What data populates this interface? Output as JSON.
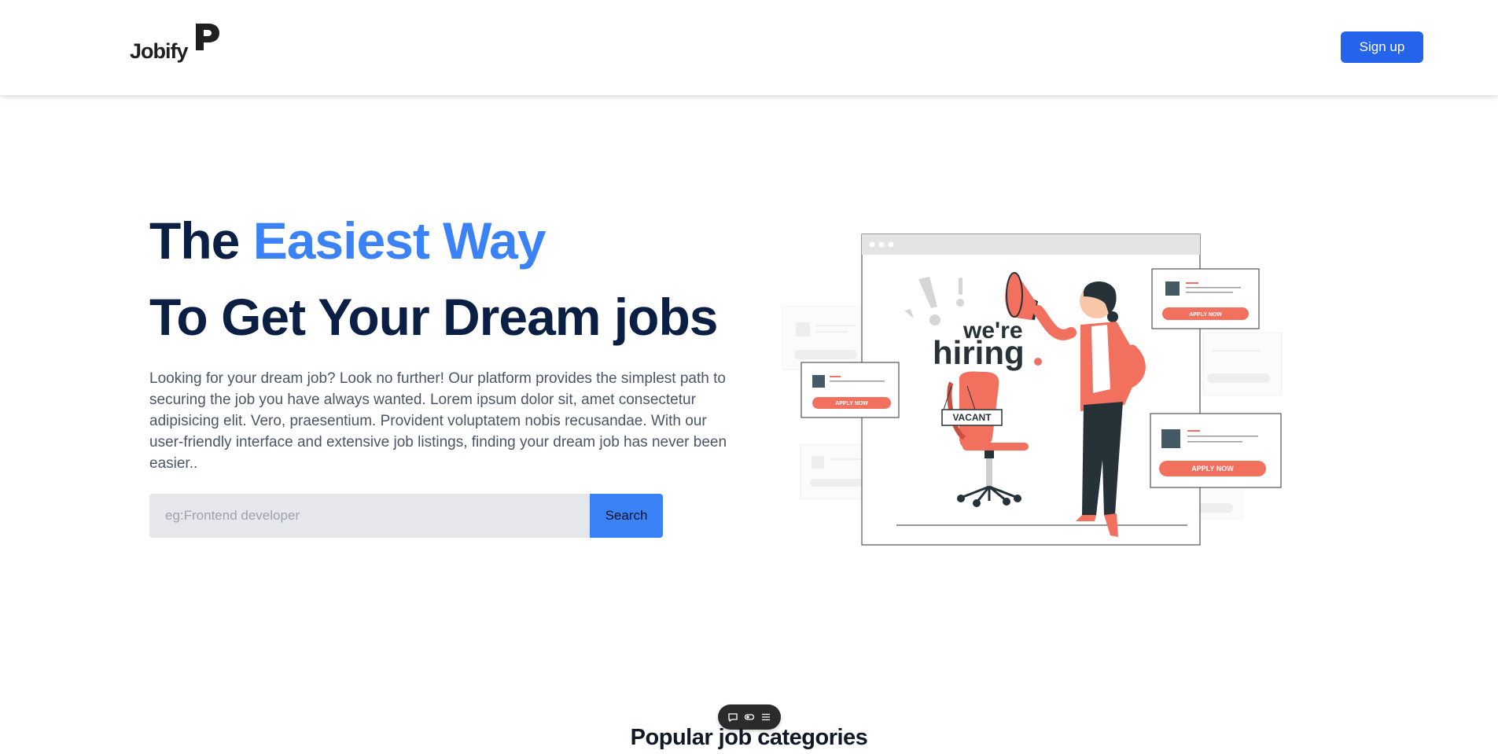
{
  "header": {
    "logo_text": "Jobify",
    "signup_label": "Sign up"
  },
  "hero": {
    "title_prefix": "The ",
    "title_accent": "Easiest Way",
    "title_line2": "To Get Your Dream jobs",
    "description": "Looking for your dream job? Look no further! Our platform provides the simplest path to securing the job you have always wanted. Lorem ipsum dolor sit, amet consectetur adipisicing elit. Vero, praesentium. Provident voluptatem nobis recusandae. With our user-friendly interface and extensive job listings, finding your dream job has never been easier.."
  },
  "search": {
    "placeholder": "eg:Frontend developer",
    "value": "",
    "button_label": "Search"
  },
  "illustration": {
    "headline_1": "we're",
    "headline_2": "hiring",
    "vacant_sign": "VACANT",
    "apply_label": "APPLY NOW"
  },
  "toolbar": {
    "icons": [
      "comment-icon",
      "toggle-icon",
      "menu-icon"
    ]
  },
  "sections": {
    "categories_title": "Popular job categories"
  },
  "colors": {
    "primary": "#2563eb",
    "accent": "#3b82f6",
    "heading": "#0b1f45",
    "coral": "#f2705e"
  }
}
